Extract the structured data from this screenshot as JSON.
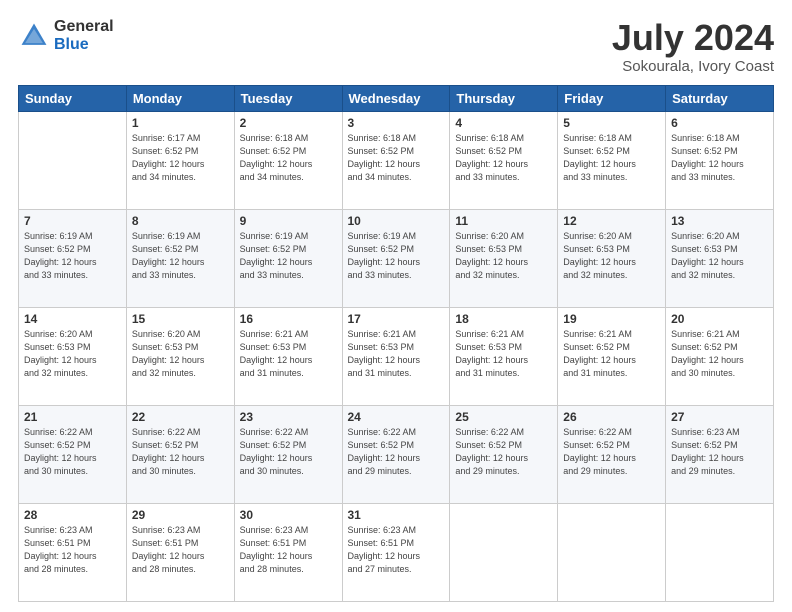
{
  "logo": {
    "general": "General",
    "blue": "Blue"
  },
  "title": "July 2024",
  "subtitle": "Sokourala, Ivory Coast",
  "days_header": [
    "Sunday",
    "Monday",
    "Tuesday",
    "Wednesday",
    "Thursday",
    "Friday",
    "Saturday"
  ],
  "weeks": [
    [
      {
        "num": "",
        "info": ""
      },
      {
        "num": "1",
        "info": "Sunrise: 6:17 AM\nSunset: 6:52 PM\nDaylight: 12 hours\nand 34 minutes."
      },
      {
        "num": "2",
        "info": "Sunrise: 6:18 AM\nSunset: 6:52 PM\nDaylight: 12 hours\nand 34 minutes."
      },
      {
        "num": "3",
        "info": "Sunrise: 6:18 AM\nSunset: 6:52 PM\nDaylight: 12 hours\nand 34 minutes."
      },
      {
        "num": "4",
        "info": "Sunrise: 6:18 AM\nSunset: 6:52 PM\nDaylight: 12 hours\nand 33 minutes."
      },
      {
        "num": "5",
        "info": "Sunrise: 6:18 AM\nSunset: 6:52 PM\nDaylight: 12 hours\nand 33 minutes."
      },
      {
        "num": "6",
        "info": "Sunrise: 6:18 AM\nSunset: 6:52 PM\nDaylight: 12 hours\nand 33 minutes."
      }
    ],
    [
      {
        "num": "7",
        "info": "Sunrise: 6:19 AM\nSunset: 6:52 PM\nDaylight: 12 hours\nand 33 minutes."
      },
      {
        "num": "8",
        "info": "Sunrise: 6:19 AM\nSunset: 6:52 PM\nDaylight: 12 hours\nand 33 minutes."
      },
      {
        "num": "9",
        "info": "Sunrise: 6:19 AM\nSunset: 6:52 PM\nDaylight: 12 hours\nand 33 minutes."
      },
      {
        "num": "10",
        "info": "Sunrise: 6:19 AM\nSunset: 6:52 PM\nDaylight: 12 hours\nand 33 minutes."
      },
      {
        "num": "11",
        "info": "Sunrise: 6:20 AM\nSunset: 6:53 PM\nDaylight: 12 hours\nand 32 minutes."
      },
      {
        "num": "12",
        "info": "Sunrise: 6:20 AM\nSunset: 6:53 PM\nDaylight: 12 hours\nand 32 minutes."
      },
      {
        "num": "13",
        "info": "Sunrise: 6:20 AM\nSunset: 6:53 PM\nDaylight: 12 hours\nand 32 minutes."
      }
    ],
    [
      {
        "num": "14",
        "info": "Sunrise: 6:20 AM\nSunset: 6:53 PM\nDaylight: 12 hours\nand 32 minutes."
      },
      {
        "num": "15",
        "info": "Sunrise: 6:20 AM\nSunset: 6:53 PM\nDaylight: 12 hours\nand 32 minutes."
      },
      {
        "num": "16",
        "info": "Sunrise: 6:21 AM\nSunset: 6:53 PM\nDaylight: 12 hours\nand 31 minutes."
      },
      {
        "num": "17",
        "info": "Sunrise: 6:21 AM\nSunset: 6:53 PM\nDaylight: 12 hours\nand 31 minutes."
      },
      {
        "num": "18",
        "info": "Sunrise: 6:21 AM\nSunset: 6:53 PM\nDaylight: 12 hours\nand 31 minutes."
      },
      {
        "num": "19",
        "info": "Sunrise: 6:21 AM\nSunset: 6:52 PM\nDaylight: 12 hours\nand 31 minutes."
      },
      {
        "num": "20",
        "info": "Sunrise: 6:21 AM\nSunset: 6:52 PM\nDaylight: 12 hours\nand 30 minutes."
      }
    ],
    [
      {
        "num": "21",
        "info": "Sunrise: 6:22 AM\nSunset: 6:52 PM\nDaylight: 12 hours\nand 30 minutes."
      },
      {
        "num": "22",
        "info": "Sunrise: 6:22 AM\nSunset: 6:52 PM\nDaylight: 12 hours\nand 30 minutes."
      },
      {
        "num": "23",
        "info": "Sunrise: 6:22 AM\nSunset: 6:52 PM\nDaylight: 12 hours\nand 30 minutes."
      },
      {
        "num": "24",
        "info": "Sunrise: 6:22 AM\nSunset: 6:52 PM\nDaylight: 12 hours\nand 29 minutes."
      },
      {
        "num": "25",
        "info": "Sunrise: 6:22 AM\nSunset: 6:52 PM\nDaylight: 12 hours\nand 29 minutes."
      },
      {
        "num": "26",
        "info": "Sunrise: 6:22 AM\nSunset: 6:52 PM\nDaylight: 12 hours\nand 29 minutes."
      },
      {
        "num": "27",
        "info": "Sunrise: 6:23 AM\nSunset: 6:52 PM\nDaylight: 12 hours\nand 29 minutes."
      }
    ],
    [
      {
        "num": "28",
        "info": "Sunrise: 6:23 AM\nSunset: 6:51 PM\nDaylight: 12 hours\nand 28 minutes."
      },
      {
        "num": "29",
        "info": "Sunrise: 6:23 AM\nSunset: 6:51 PM\nDaylight: 12 hours\nand 28 minutes."
      },
      {
        "num": "30",
        "info": "Sunrise: 6:23 AM\nSunset: 6:51 PM\nDaylight: 12 hours\nand 28 minutes."
      },
      {
        "num": "31",
        "info": "Sunrise: 6:23 AM\nSunset: 6:51 PM\nDaylight: 12 hours\nand 27 minutes."
      },
      {
        "num": "",
        "info": ""
      },
      {
        "num": "",
        "info": ""
      },
      {
        "num": "",
        "info": ""
      }
    ]
  ]
}
